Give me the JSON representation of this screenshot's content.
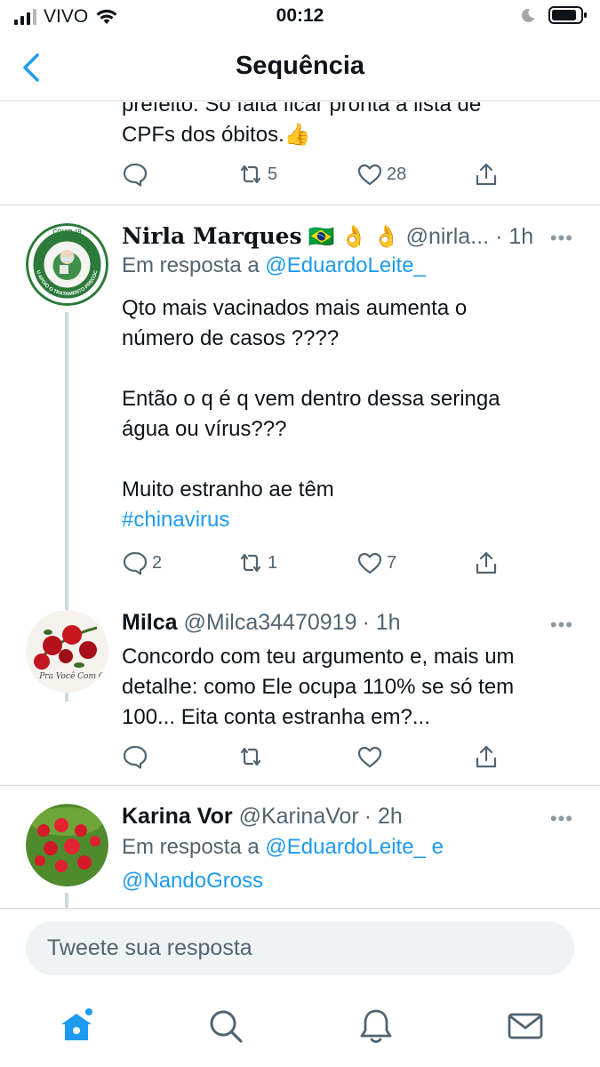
{
  "status_bar": {
    "carrier": "VIVO",
    "time": "00:12"
  },
  "header": {
    "title": "Sequência",
    "back_icon": "chevron-left-icon"
  },
  "previous_tweet": {
    "text_line1": "prefeito. Só falta ficar pronta a lista de",
    "text_line2": "CPFs dos óbitos.",
    "emoji": "👍",
    "replies": "",
    "retweets": "5",
    "likes": "28"
  },
  "tweets": [
    {
      "name": "Nirla Marques",
      "name_emojis": "🇧🇷 👌 👌",
      "handle": "@nirla...",
      "time": "· 1h",
      "reply_prefix": "Em resposta a",
      "reply_to": "@EduardoLeite_",
      "avatar_text_top": "COVID-19",
      "avatar_text_ring": "EU APOIO O TRATAMENTO PRECOCE",
      "lines": [
        "Qto mais vacinados mais aumenta o",
        "número de casos ????",
        "Então o q é q vem dentro dessa seringa",
        "água ou vírus???",
        "Muito estranho ae têm"
      ],
      "hashtag": "#chinavirus",
      "replies": "2",
      "retweets": "1",
      "likes": "7"
    },
    {
      "name": "Milca",
      "handle": "@Milca34470919",
      "time": "· 1h",
      "avatar_text": "Pra Você Com C",
      "lines": [
        "Concordo com teu argumento e, mais um",
        "detalhe: como Ele ocupa 110% se só tem",
        "100... Eita conta estranha em?..."
      ],
      "replies": "",
      "retweets": "",
      "likes": ""
    },
    {
      "name": "Karina Vor",
      "handle": "@KarinaVor",
      "time": "· 2h",
      "reply_prefix": "Em resposta a",
      "reply_to": "@EduardoLeite_",
      "reply_and": "e",
      "reply_to_2": "@NandoGross"
    }
  ],
  "reply_box": {
    "placeholder": "Tweete sua resposta"
  },
  "tab_bar": {
    "items": [
      "home-icon",
      "search-icon",
      "notifications-icon",
      "messages-icon"
    ]
  },
  "colors": {
    "accent": "#1d9bf0",
    "secondary_text": "#536471",
    "divider": "#d6d9db"
  }
}
